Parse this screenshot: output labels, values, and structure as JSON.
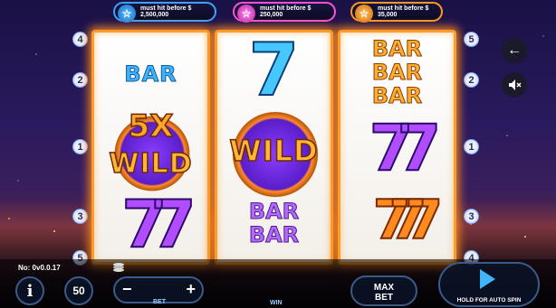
{
  "jackpots": [
    {
      "label": "must hit before $ 2,500,000",
      "color": "#3aa4ff",
      "icon": "star-icon"
    },
    {
      "label": "must hit before $ 250,000",
      "color": "#ff4fd8",
      "icon": "star-icon"
    },
    {
      "label": "must hit before $ 35,000",
      "color": "#ff9a1e",
      "icon": "star-icon"
    }
  ],
  "reels": {
    "reel1": {
      "bar": "BAR",
      "multiplier": "5X",
      "wild": "WILD",
      "sevens": "77"
    },
    "reel2": {
      "seven": "7",
      "wild": "WILD",
      "bar_top": "BAR",
      "bar_bottom": "BAR"
    },
    "reel3": {
      "bar1": "BAR",
      "bar2": "BAR",
      "bar3": "BAR",
      "sevens_mid": "77",
      "sevens_low": "777"
    }
  },
  "paylines_left": [
    "4",
    "2",
    "1",
    "3",
    "5"
  ],
  "paylines_right": [
    "5",
    "2",
    "1",
    "3",
    "4"
  ],
  "side_buttons": {
    "back_icon": "arrow-left-icon",
    "sound_icon": "speaker-muted-icon"
  },
  "footer": {
    "version": "No: 0v0.0.17",
    "info_label": "i",
    "lines_value": "50",
    "bet_minus": "−",
    "bet_plus": "+",
    "bet_label": "BET",
    "win_label": "WIN",
    "max_bet_line1": "MAX",
    "max_bet_line2": "BET",
    "spin_label": "HOLD FOR AUTO SPIN"
  },
  "colors": {
    "reel_border": "#ff9b2a",
    "accent_blue": "#3fb4ff",
    "accent_purple": "#b24cff",
    "accent_orange": "#ff8a1e"
  }
}
